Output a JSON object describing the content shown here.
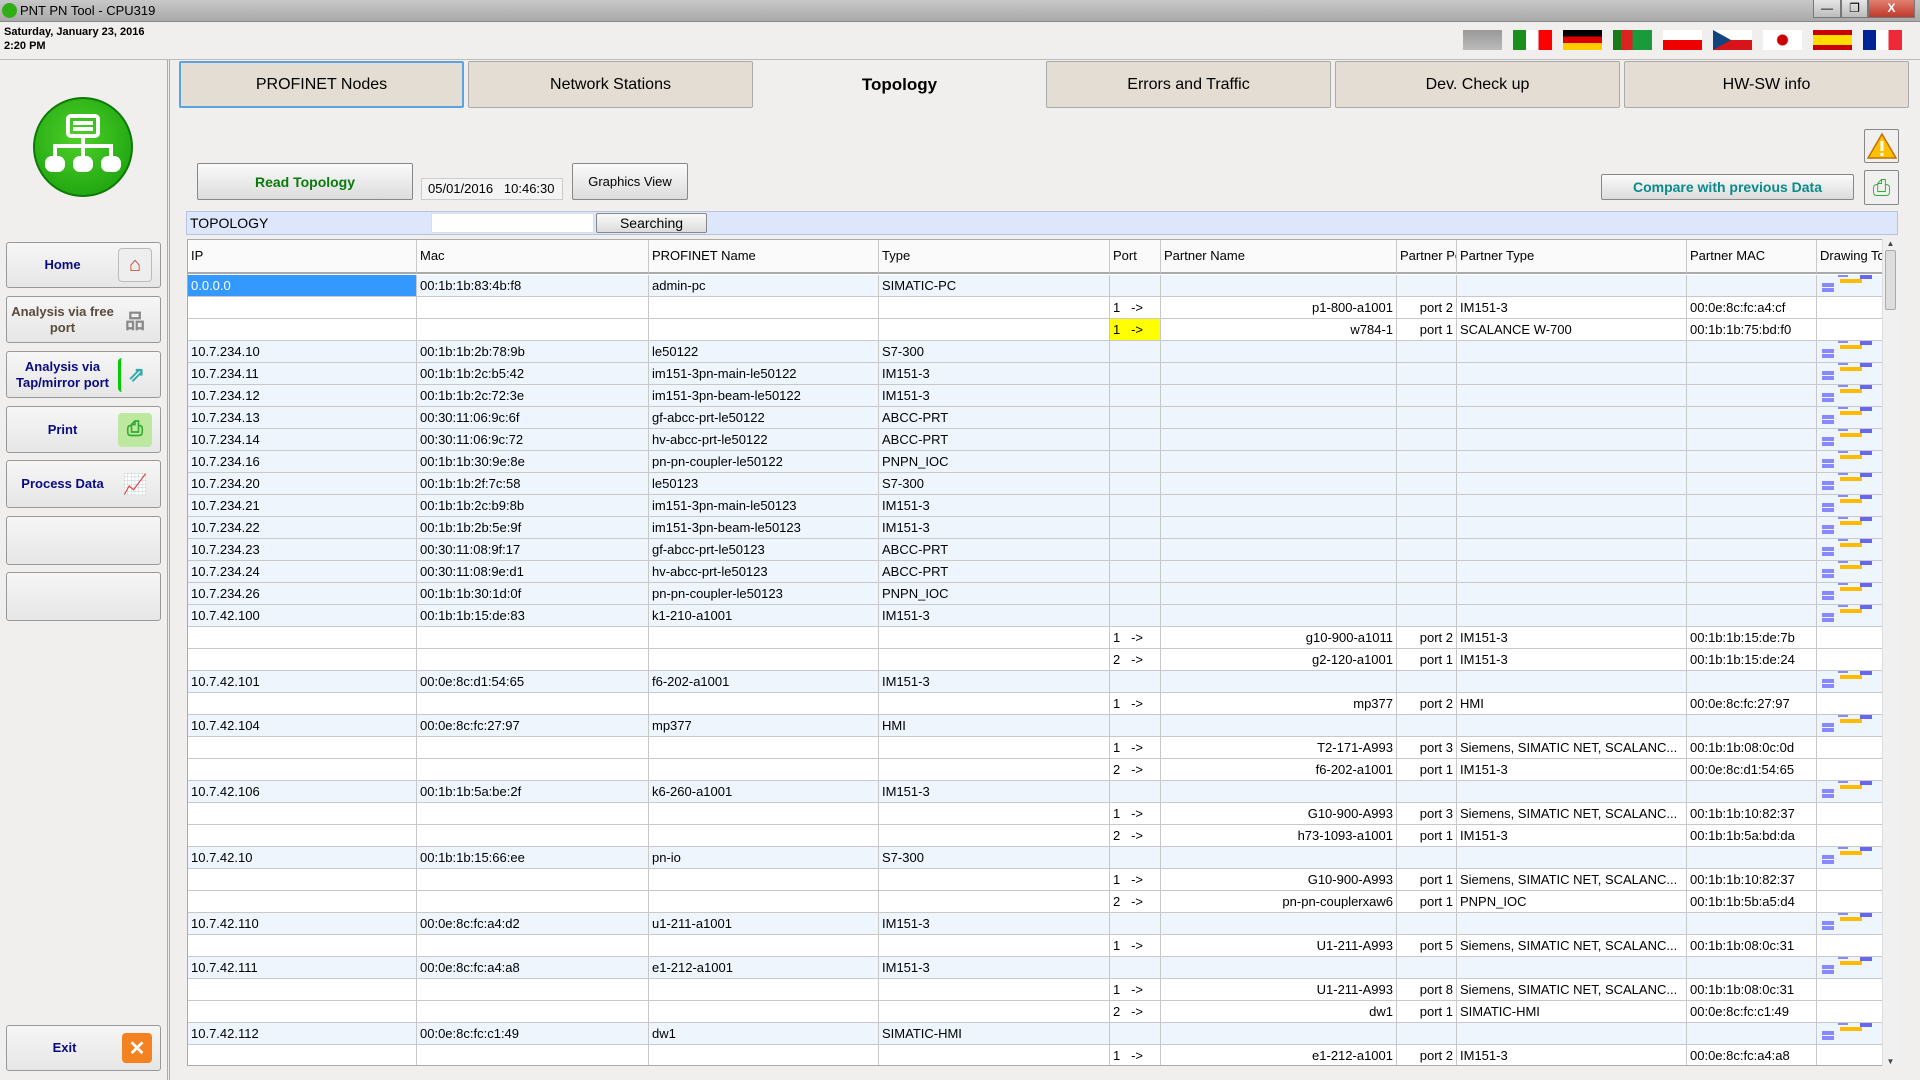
{
  "window": {
    "title": "PNT PN Tool - CPU319",
    "minimize": "—",
    "restore": "❐",
    "close": "X"
  },
  "datetime": {
    "date": "Saturday, January 23, 2016",
    "time": "2:20 PM"
  },
  "flags": [
    "uk-flag",
    "italy-flag",
    "germany-flag",
    "portugal-brazil-flag",
    "poland-flag",
    "czech-flag",
    "korea-flag",
    "spain-flag",
    "france-flag"
  ],
  "sidebar": {
    "logo": "network-topology-logo",
    "items": [
      {
        "label": "Home",
        "icon": "home-icon"
      },
      {
        "label": "Analysis via free port",
        "icon": "network-icon"
      },
      {
        "label": "Analysis via Tap/mirror port",
        "icon": "tap-mirror-icon"
      },
      {
        "label": "Print",
        "icon": "printer-icon"
      },
      {
        "label": "Process Data",
        "icon": "chart-icon"
      },
      {
        "label": "",
        "icon": ""
      },
      {
        "label": "",
        "icon": ""
      }
    ],
    "exit": "Exit"
  },
  "tabs": [
    "PROFINET Nodes",
    "Network Stations",
    "Topology",
    "Errors and Traffic",
    "Dev. Check up",
    "HW-SW info"
  ],
  "active_tab": "Topology",
  "toolbar": {
    "read": "Read Topology",
    "date": "05/01/2016   10:46:30",
    "graphics": "Graphics View",
    "compare": "Compare with previous Data"
  },
  "topology_bar": {
    "label": "TOPOLOGY",
    "search_value": "",
    "search_button": "Searching"
  },
  "columns": [
    "IP",
    "Mac",
    "PROFINET Name",
    "Type",
    "Port",
    "Partner Name",
    "Partner Port",
    "Partner Type",
    "Partner MAC",
    "Drawing Topology"
  ],
  "colors": {
    "selected": "#3399ff",
    "highlight": "#ffff00",
    "device_row": "#eef5fd",
    "read_text": "#0a7a0a",
    "compare_text": "#0a8a8a"
  },
  "rows": [
    {
      "ip": "0.0.0.0",
      "mac": "00:1b:1b:83:4b:f8",
      "name": "admin-pc",
      "type": "SIMATIC-PC",
      "selected": true
    },
    {
      "port": "1",
      "arrow": "->",
      "pname": "p1-800-a1001",
      "pport": "port 2",
      "ptype": "IM151-3",
      "pmac": "00:0e:8c:fc:a4:cf"
    },
    {
      "port": "1",
      "arrow": "->",
      "pname": "w784-1",
      "pport": "port 1",
      "ptype": "SCALANCE W-700",
      "pmac": "00:1b:1b:75:bd:f0",
      "highlight": true
    },
    {
      "ip": "10.7.234.10",
      "mac": "00:1b:1b:2b:78:9b",
      "name": "le50122",
      "type": "S7-300"
    },
    {
      "ip": "10.7.234.11",
      "mac": "00:1b:1b:2c:b5:42",
      "name": "im151-3pn-main-le50122",
      "type": "IM151-3"
    },
    {
      "ip": "10.7.234.12",
      "mac": "00:1b:1b:2c:72:3e",
      "name": "im151-3pn-beam-le50122",
      "type": "IM151-3"
    },
    {
      "ip": "10.7.234.13",
      "mac": "00:30:11:06:9c:6f",
      "name": "gf-abcc-prt-le50122",
      "type": "ABCC-PRT"
    },
    {
      "ip": "10.7.234.14",
      "mac": "00:30:11:06:9c:72",
      "name": "hv-abcc-prt-le50122",
      "type": "ABCC-PRT"
    },
    {
      "ip": "10.7.234.16",
      "mac": "00:1b:1b:30:9e:8e",
      "name": "pn-pn-coupler-le50122",
      "type": "PNPN_IOC"
    },
    {
      "ip": "10.7.234.20",
      "mac": "00:1b:1b:2f:7c:58",
      "name": "le50123",
      "type": "S7-300"
    },
    {
      "ip": "10.7.234.21",
      "mac": "00:1b:1b:2c:b9:8b",
      "name": "im151-3pn-main-le50123",
      "type": "IM151-3"
    },
    {
      "ip": "10.7.234.22",
      "mac": "00:1b:1b:2b:5e:9f",
      "name": "im151-3pn-beam-le50123",
      "type": "IM151-3"
    },
    {
      "ip": "10.7.234.23",
      "mac": "00:30:11:08:9f:17",
      "name": "gf-abcc-prt-le50123",
      "type": "ABCC-PRT"
    },
    {
      "ip": "10.7.234.24",
      "mac": "00:30:11:08:9e:d1",
      "name": "hv-abcc-prt-le50123",
      "type": "ABCC-PRT"
    },
    {
      "ip": "10.7.234.26",
      "mac": "00:1b:1b:30:1d:0f",
      "name": "pn-pn-coupler-le50123",
      "type": "PNPN_IOC"
    },
    {
      "ip": "10.7.42.100",
      "mac": "00:1b:1b:15:de:83",
      "name": "k1-210-a1001",
      "type": "IM151-3"
    },
    {
      "port": "1",
      "arrow": "->",
      "pname": "g10-900-a1011",
      "pport": "port 2",
      "ptype": "IM151-3",
      "pmac": "00:1b:1b:15:de:7b"
    },
    {
      "port": "2",
      "arrow": "->",
      "pname": "g2-120-a1001",
      "pport": "port 1",
      "ptype": "IM151-3",
      "pmac": "00:1b:1b:15:de:24"
    },
    {
      "ip": "10.7.42.101",
      "mac": "00:0e:8c:d1:54:65",
      "name": "f6-202-a1001",
      "type": "IM151-3"
    },
    {
      "port": "1",
      "arrow": "->",
      "pname": "mp377",
      "pport": "port 2",
      "ptype": "HMI",
      "pmac": "00:0e:8c:fc:27:97"
    },
    {
      "ip": "10.7.42.104",
      "mac": "00:0e:8c:fc:27:97",
      "name": "mp377",
      "type": "HMI"
    },
    {
      "port": "1",
      "arrow": "->",
      "pname": "T2-171-A993",
      "pport": "port 3",
      "ptype": "Siemens, SIMATIC NET, SCALANC...",
      "pmac": "00:1b:1b:08:0c:0d"
    },
    {
      "port": "2",
      "arrow": "->",
      "pname": "f6-202-a1001",
      "pport": "port 1",
      "ptype": "IM151-3",
      "pmac": "00:0e:8c:d1:54:65"
    },
    {
      "ip": "10.7.42.106",
      "mac": "00:1b:1b:5a:be:2f",
      "name": "k6-260-a1001",
      "type": "IM151-3"
    },
    {
      "port": "1",
      "arrow": "->",
      "pname": "G10-900-A993",
      "pport": "port 3",
      "ptype": "Siemens, SIMATIC NET, SCALANC...",
      "pmac": "00:1b:1b:10:82:37"
    },
    {
      "port": "2",
      "arrow": "->",
      "pname": "h73-1093-a1001",
      "pport": "port 1",
      "ptype": "IM151-3",
      "pmac": "00:1b:1b:5a:bd:da"
    },
    {
      "ip": "10.7.42.10",
      "mac": "00:1b:1b:15:66:ee",
      "name": "pn-io",
      "type": "S7-300"
    },
    {
      "port": "1",
      "arrow": "->",
      "pname": "G10-900-A993",
      "pport": "port 1",
      "ptype": "Siemens, SIMATIC NET, SCALANC...",
      "pmac": "00:1b:1b:10:82:37"
    },
    {
      "port": "2",
      "arrow": "->",
      "pname": "pn-pn-couplerxaw6",
      "pport": "port 1",
      "ptype": "PNPN_IOC",
      "pmac": "00:1b:1b:5b:a5:d4"
    },
    {
      "ip": "10.7.42.110",
      "mac": "00:0e:8c:fc:a4:d2",
      "name": "u1-211-a1001",
      "type": "IM151-3"
    },
    {
      "port": "1",
      "arrow": "->",
      "pname": "U1-211-A993",
      "pport": "port 5",
      "ptype": "Siemens, SIMATIC NET, SCALANC...",
      "pmac": "00:1b:1b:08:0c:31"
    },
    {
      "ip": "10.7.42.111",
      "mac": "00:0e:8c:fc:a4:a8",
      "name": "e1-212-a1001",
      "type": "IM151-3"
    },
    {
      "port": "1",
      "arrow": "->",
      "pname": "U1-211-A993",
      "pport": "port 8",
      "ptype": "Siemens, SIMATIC NET, SCALANC...",
      "pmac": "00:1b:1b:08:0c:31"
    },
    {
      "port": "2",
      "arrow": "->",
      "pname": "dw1",
      "pport": "port 1",
      "ptype": "SIMATIC-HMI",
      "pmac": "00:0e:8c:fc:c1:49"
    },
    {
      "ip": "10.7.42.112",
      "mac": "00:0e:8c:fc:c1:49",
      "name": "dw1",
      "type": "SIMATIC-HMI"
    },
    {
      "port": "1",
      "arrow": "->",
      "pname": "e1-212-a1001",
      "pport": "port 2",
      "ptype": "IM151-3",
      "pmac": "00:0e:8c:fc:a4:a8"
    }
  ]
}
